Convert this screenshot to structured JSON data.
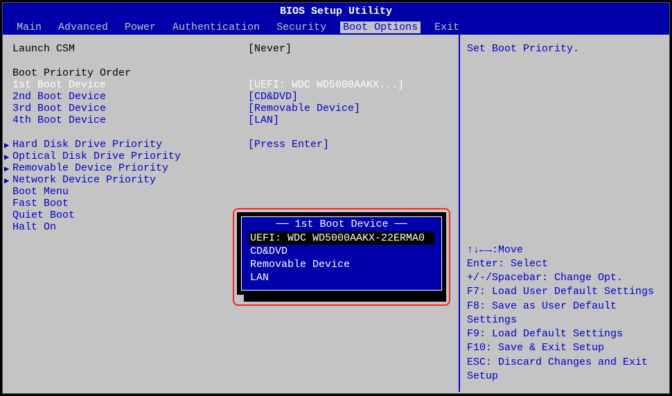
{
  "title": "BIOS Setup Utility",
  "tabs": [
    "Main",
    "Advanced",
    "Power",
    "Authentication",
    "Security",
    "Boot Options",
    "Exit"
  ],
  "activeTab": "Boot Options",
  "main": {
    "launchCSM": {
      "label": "Launch CSM",
      "value": "[Never]"
    },
    "bootOrderHeader": "Boot Priority Order",
    "bootDevices": [
      {
        "label": "1st Boot Device",
        "value": "[UEFI: WDC WD5000AAKX...]",
        "selected": true,
        "blue": false
      },
      {
        "label": "2nd Boot Device",
        "value": "[CD&DVD]",
        "blue": true
      },
      {
        "label": "3rd Boot Device",
        "value": "[Removable Device]",
        "blue": true
      },
      {
        "label": "4th Boot Device",
        "value": "[LAN]",
        "blue": true
      }
    ],
    "submenus": [
      {
        "label": "Hard Disk Drive Priority",
        "value": "[Press Enter]",
        "arrow": true,
        "showValue": true
      },
      {
        "label": "Optical Disk Drive Priority",
        "arrow": true
      },
      {
        "label": "Removable Device Priority",
        "arrow": true
      },
      {
        "label": "Network Device Priority",
        "arrow": true
      },
      {
        "label": "Boot Menu"
      },
      {
        "label": "Fast Boot"
      },
      {
        "label": "Quiet Boot"
      },
      {
        "label": "Halt On"
      }
    ]
  },
  "popup": {
    "title": "1st Boot Device",
    "items": [
      "UEFI: WDC WD5000AAKX-22ERMA0",
      "CD&DVD",
      "Removable Device",
      "LAN"
    ],
    "selectedIndex": 0
  },
  "help": {
    "description": "Set Boot Priority.",
    "keys": [
      "↑↓←→:Move",
      "Enter: Select",
      "+/-/Spacebar: Change Opt.",
      "F7: Load User Default Settings",
      "F8: Save as User Default Settings",
      "F9: Load Default Settings",
      "F10: Save & Exit Setup",
      "ESC: Discard Changes and Exit Setup"
    ]
  }
}
